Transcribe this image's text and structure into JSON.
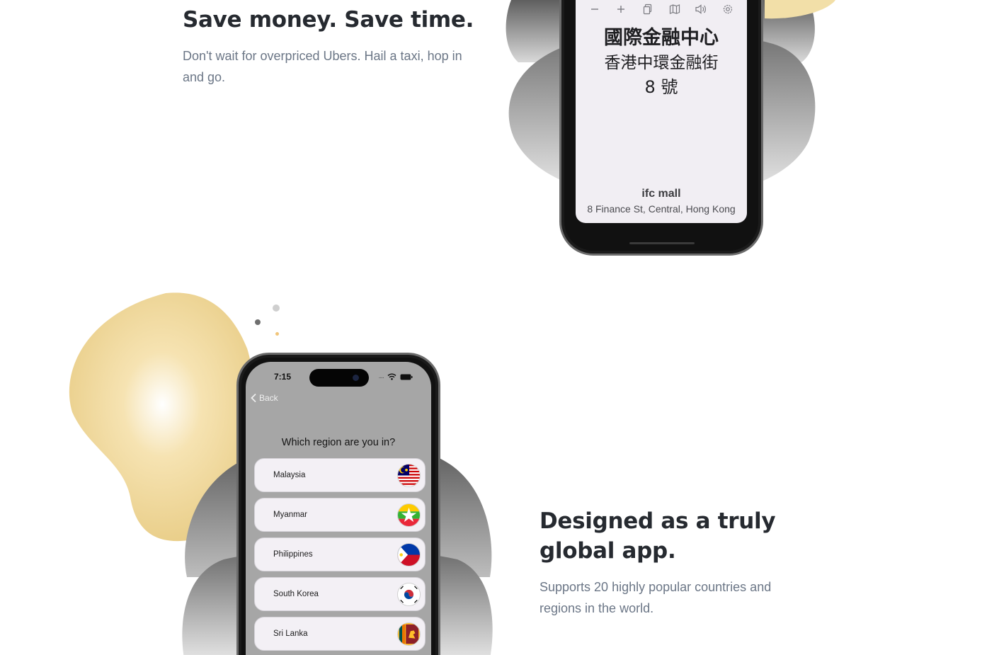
{
  "section1": {
    "title": "Save money. Save time.",
    "description": "Don't wait for overpriced Ubers. Hail a taxi, hop in and go."
  },
  "phone1": {
    "toolbar_icons": [
      "minus-icon",
      "plus-icon",
      "copy-icon",
      "map-icon",
      "speaker-icon",
      "gear-icon"
    ],
    "chinese_name": "國際金融中心",
    "chinese_address_line1": "香港中環金融街",
    "chinese_address_line2": "8 號",
    "place_name": "ifc mall",
    "place_address": "8 Finance St, Central, Hong Kong"
  },
  "phone2": {
    "status_time": "7:15",
    "back_label": "Back",
    "question": "Which region are you in?",
    "regions": [
      {
        "label": "Malaysia",
        "flag": "malaysia-flag-icon"
      },
      {
        "label": "Myanmar",
        "flag": "myanmar-flag-icon"
      },
      {
        "label": "Philippines",
        "flag": "philippines-flag-icon"
      },
      {
        "label": "South Korea",
        "flag": "south-korea-flag-icon"
      },
      {
        "label": "Sri Lanka",
        "flag": "sri-lanka-flag-icon"
      }
    ]
  },
  "section2": {
    "title": "Designed as a truly global app.",
    "description": "Supports 20 highly popular countries and regions in the world."
  },
  "colors": {
    "heading": "#262a30",
    "body_text": "#6b7686",
    "accent_blob": "#ecd18b",
    "grey_blob": "#8a8a8a"
  }
}
